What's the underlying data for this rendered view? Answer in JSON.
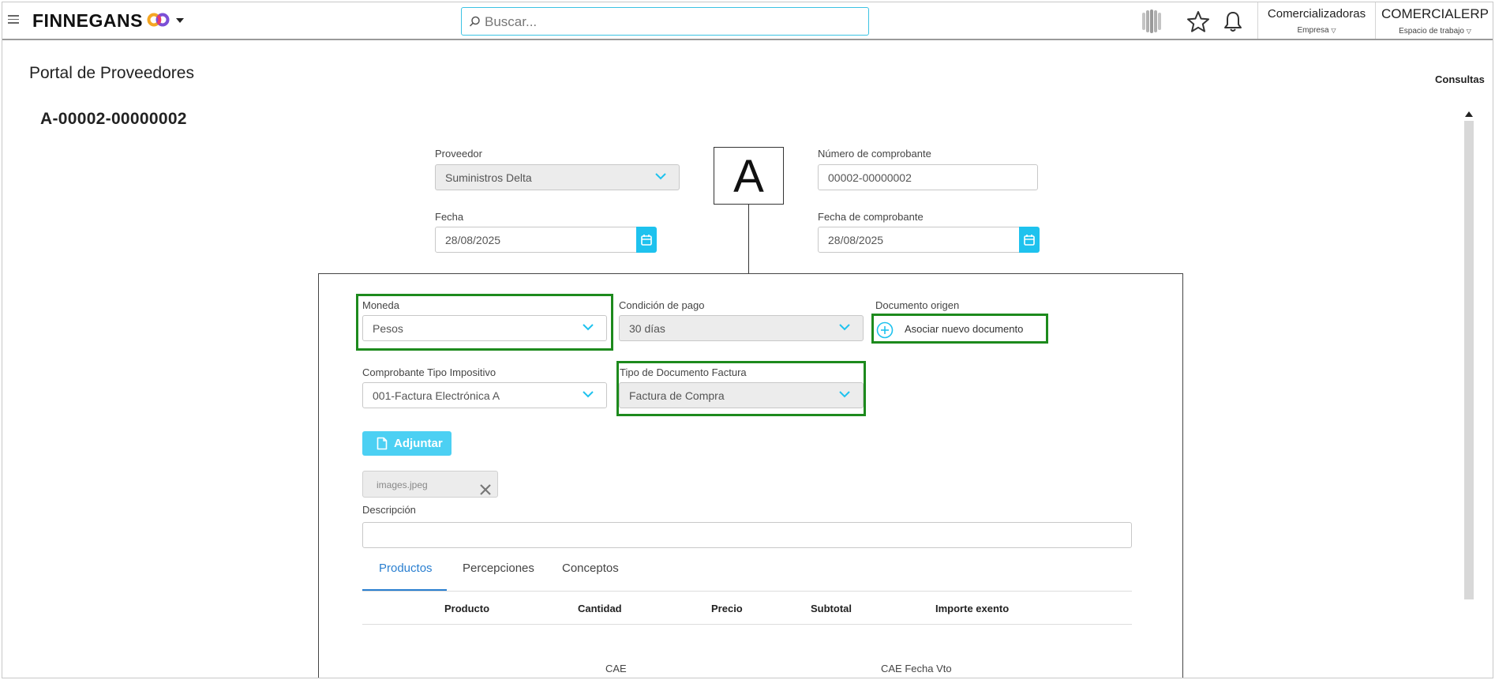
{
  "topbar": {
    "brand": "FINNEGANS",
    "search_placeholder": "Buscar...",
    "company": {
      "name": "Comercializadoras",
      "sub": "Empresa"
    },
    "workspace": {
      "name": "COMERCIALERP",
      "sub": "Espacio de trabajo"
    }
  },
  "page": {
    "title": "Portal de Proveedores",
    "consultas": "Consultas",
    "doc_number": "A-00002-00000002",
    "letter": "A"
  },
  "header_fields": {
    "proveedor_label": "Proveedor",
    "proveedor_value": "Suministros Delta",
    "fecha_label": "Fecha",
    "fecha_value": "28/08/2025",
    "numero_label": "Número de comprobante",
    "numero_value": "00002-00000002",
    "fecha_comp_label": "Fecha de comprobante",
    "fecha_comp_value": "28/08/2025"
  },
  "panel": {
    "moneda_label": "Moneda",
    "moneda_value": "Pesos",
    "condicion_label": "Condición de pago",
    "condicion_value": "30 días",
    "doc_origen_label": "Documento origen",
    "asociar_label": "Asociar nuevo documento",
    "tipo_impositivo_label": "Comprobante Tipo Impositivo",
    "tipo_impositivo_value": "001-Factura Electrónica A",
    "tipo_doc_label": "Tipo de Documento Factura",
    "tipo_doc_value": "Factura de Compra",
    "adjuntar_label": "Adjuntar",
    "file_name": "images.jpeg",
    "descripcion_label": "Descripción",
    "descripcion_value": "",
    "tabs": [
      "Productos",
      "Percepciones",
      "Conceptos"
    ],
    "columns": [
      "Producto",
      "Cantidad",
      "Precio",
      "Subtotal",
      "Importe exento"
    ],
    "cae_label": "CAE",
    "cae_fecha_label": "CAE Fecha Vto"
  },
  "colors": {
    "accent": "#1ec2ee",
    "highlight": "#1d8a1d",
    "tab_active": "#2a7fd0"
  }
}
